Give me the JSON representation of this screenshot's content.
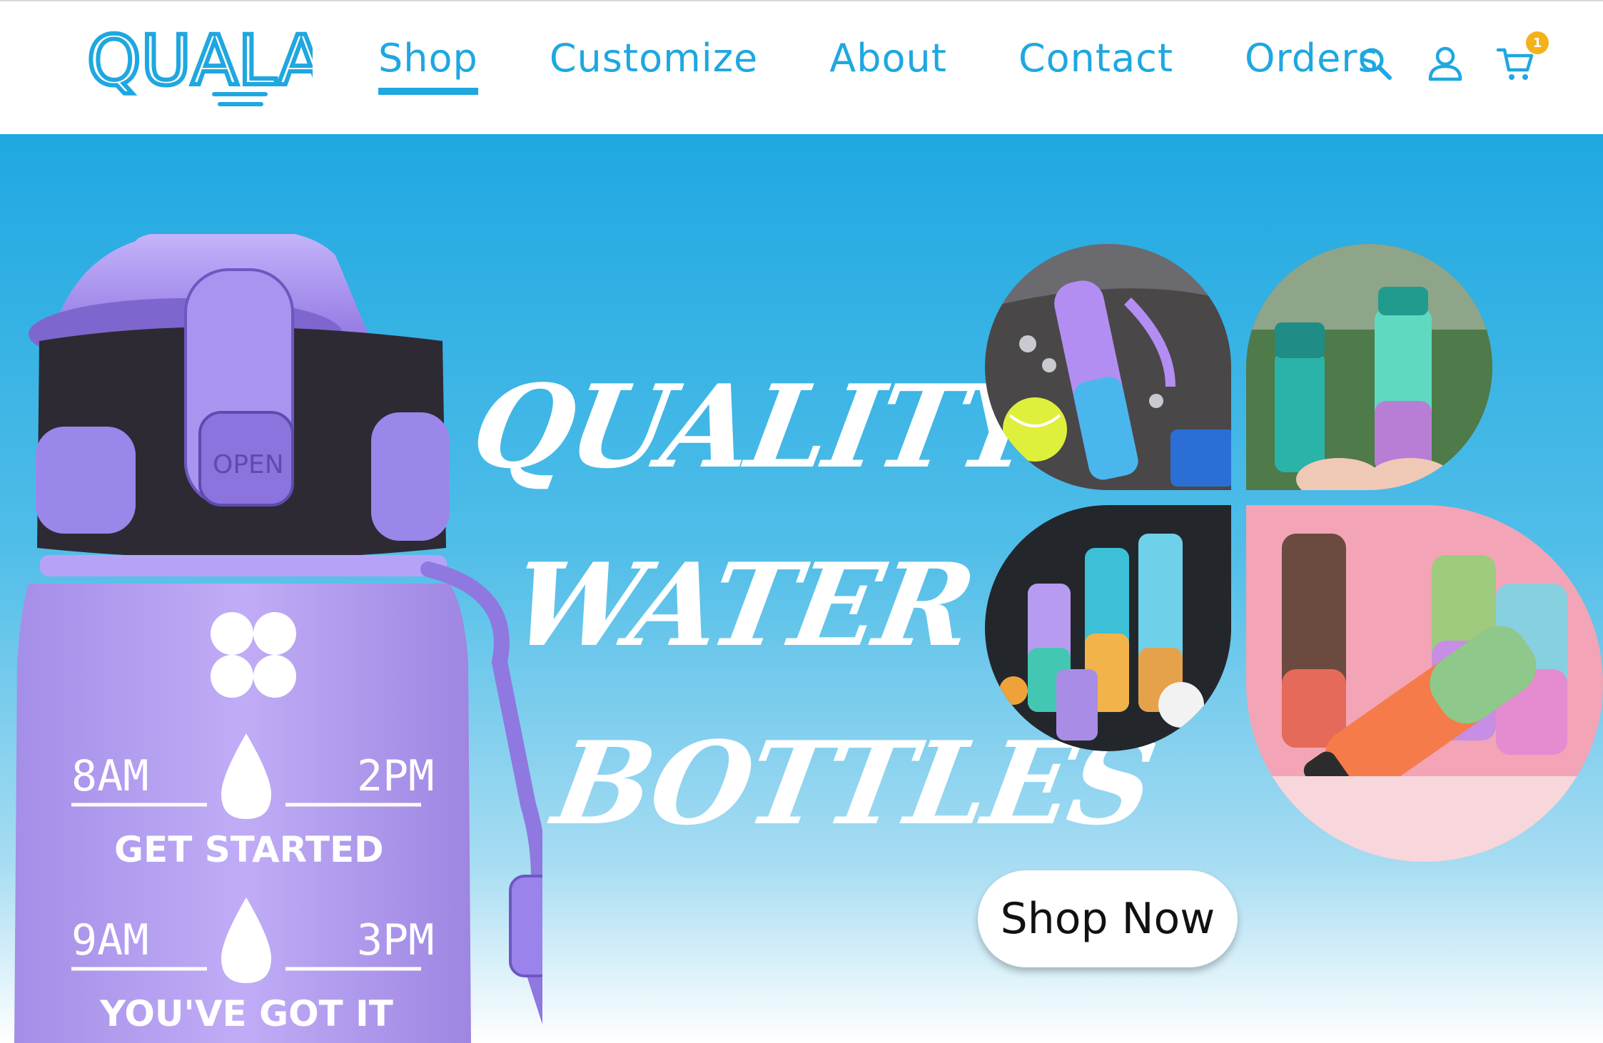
{
  "brand": {
    "logo_text": "QUALA"
  },
  "nav": {
    "items": [
      {
        "label": "Shop",
        "active": true
      },
      {
        "label": "Customize",
        "active": false
      },
      {
        "label": "About",
        "active": false
      },
      {
        "label": "Contact",
        "active": false
      },
      {
        "label": "Orders",
        "active": false
      }
    ]
  },
  "header_icons": {
    "search": "search-icon",
    "account": "user-icon",
    "cart": "cart-icon",
    "cart_count": "1"
  },
  "hero": {
    "headline_line1": "QUALITY",
    "headline_line2": "WATER",
    "headline_line3": "BOTTLES",
    "cta_label": "Shop Now",
    "bottle": {
      "lid_text": "OPEN",
      "marker1_left": "8AM",
      "marker1_right": "2PM",
      "marker1_text": "GET STARTED",
      "marker2_left": "9AM",
      "marker2_right": "3PM",
      "marker2_text": "YOU'VE GOT IT"
    }
  },
  "colors": {
    "brand_blue": "#1fa7e0",
    "badge": "#f3b21b",
    "bottle_purple": "#b6a0f2"
  }
}
